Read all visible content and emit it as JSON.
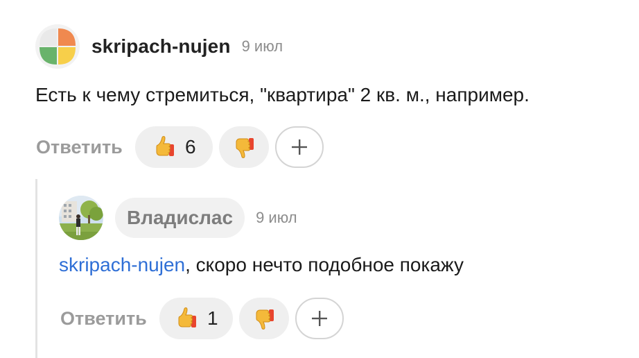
{
  "top_comment": {
    "author": "skripach-nujen",
    "date": "9 июл",
    "text": "Есть к чему стремиться, \"квартира\" 2 кв. м., например.",
    "reply_label": "Ответить",
    "reactions": [
      {
        "icon": "thumbs-up-emoji-icon",
        "count": "6"
      },
      {
        "icon": "thumbs-down-emoji-icon",
        "count": ""
      }
    ],
    "add_reaction_icon": "plus-icon"
  },
  "reply_comment": {
    "author": "Владислас",
    "date": "9 июл",
    "mention": "skripach-nujen",
    "text": ", скоро нечто подобное покажу",
    "reply_label": "Ответить",
    "reactions": [
      {
        "icon": "thumbs-up-emoji-icon",
        "count": "1"
      },
      {
        "icon": "thumbs-down-emoji-icon",
        "count": ""
      }
    ],
    "add_reaction_icon": "plus-icon"
  },
  "colors": {
    "link": "#2f6fd6",
    "muted": "#9b9b9b",
    "pill_bg": "#efefef",
    "avatar_orange": "#f0894f",
    "avatar_yellow": "#f7cf4a",
    "avatar_green": "#69b36b"
  }
}
